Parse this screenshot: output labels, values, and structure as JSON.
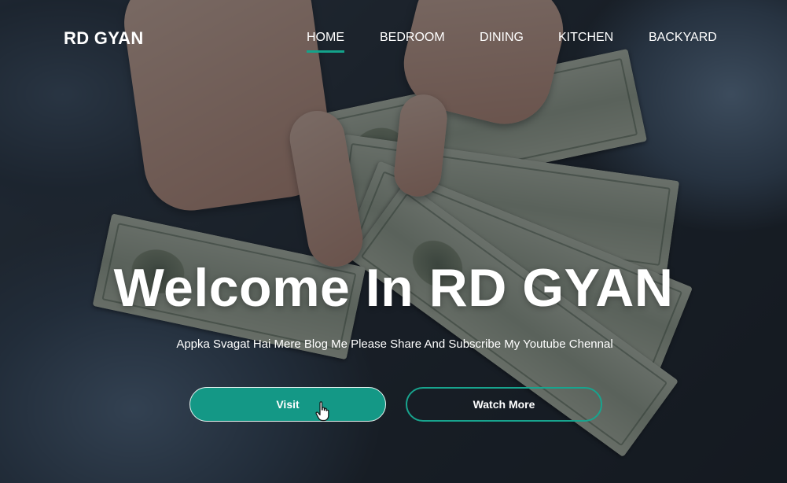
{
  "brand": {
    "logo": "RD GYAN"
  },
  "nav": {
    "active": "HOME",
    "items": [
      {
        "label": "HOME",
        "active": true
      },
      {
        "label": "BEDROOM",
        "active": false
      },
      {
        "label": "DINING",
        "active": false
      },
      {
        "label": "KITCHEN",
        "active": false
      },
      {
        "label": "BACKYARD",
        "active": false
      }
    ]
  },
  "hero": {
    "title": "Welcome In RD GYAN",
    "subtitle": "Appka Svagat Hai Mere Blog Me Please Share And Subscribe My Youtube Chennal",
    "buttons": {
      "primary": "Visit",
      "secondary": "Watch More"
    }
  },
  "colors": {
    "accent": "#149886",
    "accent_border": "#18a48e",
    "text": "#ffffff"
  },
  "icons": {
    "cursor": "hand-pointer-icon"
  }
}
